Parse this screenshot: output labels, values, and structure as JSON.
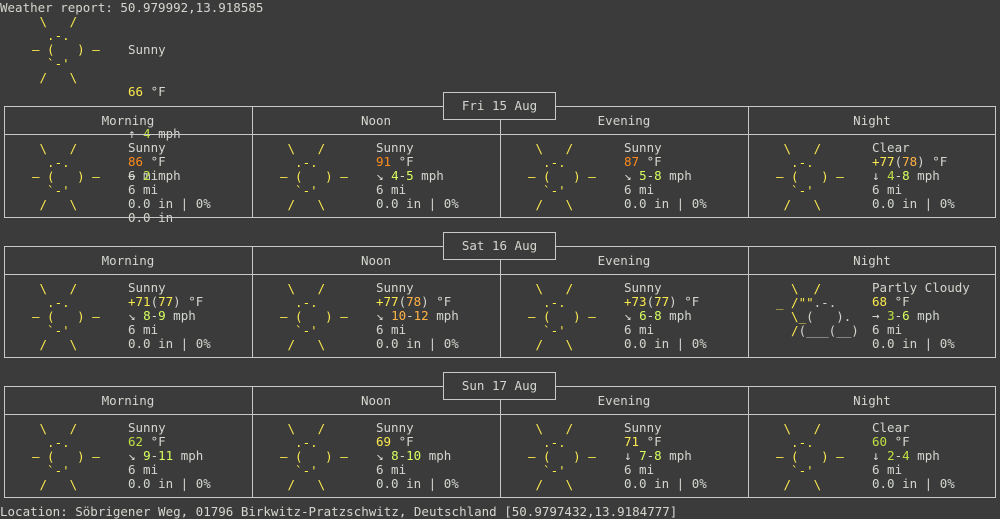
{
  "header": {
    "title": "Weather report: 50.979992,13.918585",
    "current": {
      "art": "sun",
      "cond": "Sunny",
      "temp": "66",
      "temp_color": "#fce94f",
      "temp_unit": " °F",
      "wind_dir": "↑",
      "wind": "4",
      "wind_color": "#bfe043",
      "wind_unit": " mph",
      "vis": "6 mi",
      "precip": "0.0 in"
    }
  },
  "icons": {
    "sun": [
      " \\   /    ",
      "  .-.     ",
      "― (   ) ― ",
      "  `-'     ",
      " /   \\    "
    ],
    "partly": [
      "  \\  /    ",
      "_ /\"\".-.  ",
      "  \\_(   ). ",
      "  /(___(__)",
      "          "
    ]
  },
  "periods": [
    "Morning",
    "Noon",
    "Evening",
    "Night"
  ],
  "days": [
    {
      "date": "Fri 15 Aug",
      "slots": [
        {
          "art": "sun",
          "cond": "Sunny",
          "temp": [
            {
              "t": "86",
              "c": "#ff8c1a"
            }
          ],
          "unit": " °F",
          "dir": "→",
          "wind": [
            {
              "t": "2",
              "c": "#bfe043"
            }
          ],
          "vis": "6 mi",
          "precip": "0.0 in | 0%"
        },
        {
          "art": "sun",
          "cond": "Sunny",
          "temp": [
            {
              "t": "91",
              "c": "#ff8c1a"
            }
          ],
          "unit": " °F",
          "dir": "↘",
          "wind": [
            {
              "t": "4",
              "c": "#d7ff5f"
            },
            {
              "t": "-",
              "c": ""
            },
            {
              "t": "5",
              "c": "#d7ff5f"
            }
          ],
          "vis": "6 mi",
          "precip": "0.0 in | 0%"
        },
        {
          "art": "sun",
          "cond": "Sunny",
          "temp": [
            {
              "t": "87",
              "c": "#ff8c1a"
            }
          ],
          "unit": " °F",
          "dir": "↘",
          "wind": [
            {
              "t": "5",
              "c": "#d7ff5f"
            },
            {
              "t": "-",
              "c": ""
            },
            {
              "t": "8",
              "c": "#d7ff5f"
            }
          ],
          "vis": "6 mi",
          "precip": "0.0 in | 0%"
        },
        {
          "art": "sun",
          "cond": "Clear",
          "temp": [
            {
              "t": "+77",
              "c": "#fce94f"
            },
            {
              "t": "(",
              "c": ""
            },
            {
              "t": "78",
              "c": "#ffb347"
            },
            {
              "t": ")",
              "c": ""
            }
          ],
          "unit": " °F",
          "dir": "↓",
          "wind": [
            {
              "t": "4",
              "c": "#bfe043"
            },
            {
              "t": "-",
              "c": ""
            },
            {
              "t": "8",
              "c": "#d7ff5f"
            }
          ],
          "vis": "6 mi",
          "precip": "0.0 in | 0%"
        }
      ]
    },
    {
      "date": "Sat 16 Aug",
      "slots": [
        {
          "art": "sun",
          "cond": "Sunny",
          "temp": [
            {
              "t": "+71",
              "c": "#fce94f"
            },
            {
              "t": "(",
              "c": ""
            },
            {
              "t": "77",
              "c": "#fce94f"
            },
            {
              "t": ")",
              "c": ""
            }
          ],
          "unit": " °F",
          "dir": "↘",
          "wind": [
            {
              "t": "8",
              "c": "#d7ff5f"
            },
            {
              "t": "-",
              "c": ""
            },
            {
              "t": "9",
              "c": "#d7ff5f"
            }
          ],
          "vis": "6 mi",
          "precip": "0.0 in | 0%"
        },
        {
          "art": "sun",
          "cond": "Sunny",
          "temp": [
            {
              "t": "+77",
              "c": "#fce94f"
            },
            {
              "t": "(",
              "c": ""
            },
            {
              "t": "78",
              "c": "#ffb347"
            },
            {
              "t": ")",
              "c": ""
            }
          ],
          "unit": " °F",
          "dir": "↘",
          "wind": [
            {
              "t": "10",
              "c": "#ffb347"
            },
            {
              "t": "-",
              "c": ""
            },
            {
              "t": "12",
              "c": "#ffb347"
            }
          ],
          "vis": "6 mi",
          "precip": "0.0 in | 0%"
        },
        {
          "art": "sun",
          "cond": "Sunny",
          "temp": [
            {
              "t": "+73",
              "c": "#fce94f"
            },
            {
              "t": "(",
              "c": ""
            },
            {
              "t": "77",
              "c": "#fce94f"
            },
            {
              "t": ")",
              "c": ""
            }
          ],
          "unit": " °F",
          "dir": "↘",
          "wind": [
            {
              "t": "6",
              "c": "#d7ff5f"
            },
            {
              "t": "-",
              "c": ""
            },
            {
              "t": "8",
              "c": "#d7ff5f"
            }
          ],
          "vis": "6 mi",
          "precip": "0.0 in | 0%"
        },
        {
          "art": "partly",
          "cond": "Partly Cloudy",
          "temp": [
            {
              "t": "68",
              "c": "#fce94f"
            }
          ],
          "unit": " °F",
          "dir": "→",
          "wind": [
            {
              "t": "3",
              "c": "#bfe043"
            },
            {
              "t": "-",
              "c": ""
            },
            {
              "t": "6",
              "c": "#d7ff5f"
            }
          ],
          "vis": "6 mi",
          "precip": "0.0 in | 0%"
        }
      ]
    },
    {
      "date": "Sun 17 Aug",
      "slots": [
        {
          "art": "sun",
          "cond": "Sunny",
          "temp": [
            {
              "t": "62",
              "c": "#bfe043"
            }
          ],
          "unit": " °F",
          "dir": "↘",
          "wind": [
            {
              "t": "9",
              "c": "#d7ff5f"
            },
            {
              "t": "-",
              "c": ""
            },
            {
              "t": "11",
              "c": "#d7ff5f"
            }
          ],
          "vis": "6 mi",
          "precip": "0.0 in | 0%"
        },
        {
          "art": "sun",
          "cond": "Sunny",
          "temp": [
            {
              "t": "69",
              "c": "#fce94f"
            }
          ],
          "unit": " °F",
          "dir": "↘",
          "wind": [
            {
              "t": "8",
              "c": "#d7ff5f"
            },
            {
              "t": "-",
              "c": ""
            },
            {
              "t": "10",
              "c": "#d7ff5f"
            }
          ],
          "vis": "6 mi",
          "precip": "0.0 in | 0%"
        },
        {
          "art": "sun",
          "cond": "Sunny",
          "temp": [
            {
              "t": "71",
              "c": "#fce94f"
            }
          ],
          "unit": " °F",
          "dir": "↓",
          "wind": [
            {
              "t": "7",
              "c": "#d7ff5f"
            },
            {
              "t": "-",
              "c": ""
            },
            {
              "t": "8",
              "c": "#d7ff5f"
            }
          ],
          "vis": "6 mi",
          "precip": "0.0 in | 0%"
        },
        {
          "art": "sun",
          "cond": "Clear",
          "temp": [
            {
              "t": "60",
              "c": "#bfe043"
            }
          ],
          "unit": " °F",
          "dir": "↓",
          "wind": [
            {
              "t": "2",
              "c": "#bfe043"
            },
            {
              "t": "-",
              "c": ""
            },
            {
              "t": "4",
              "c": "#bfe043"
            }
          ],
          "vis": "6 mi",
          "precip": "0.0 in | 0%"
        }
      ]
    }
  ],
  "footer": {
    "location": "Location: Söbrigener Weg, 01796 Birkwitz-Pratzschwitz, Deutschland [50.9797432,13.9184777]"
  }
}
